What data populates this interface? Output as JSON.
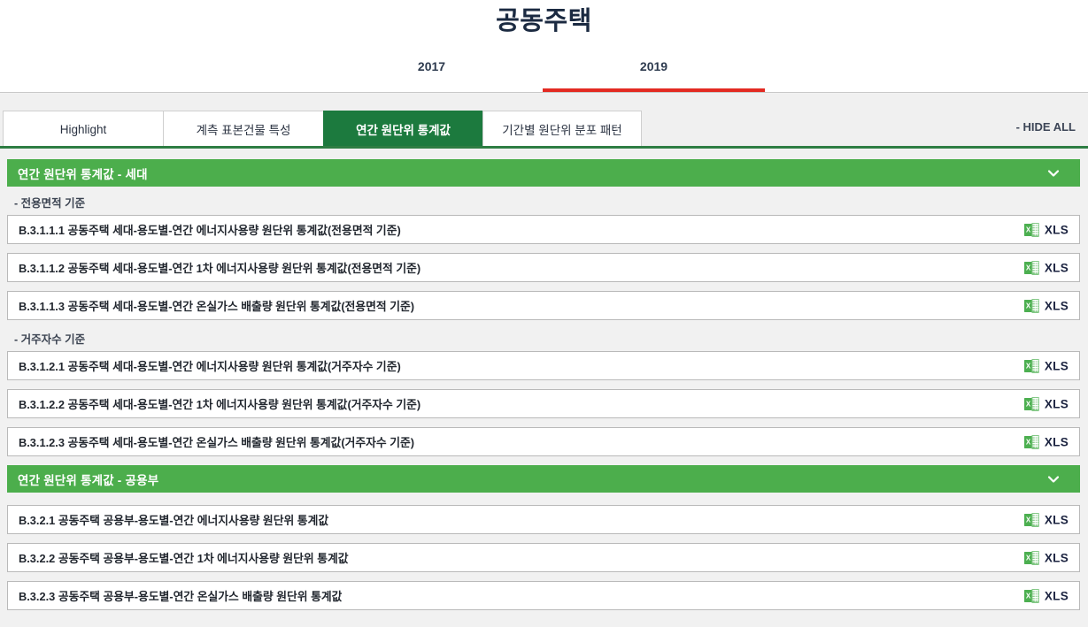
{
  "header": {
    "title": "공동주택",
    "year_tabs": [
      {
        "label": "2017",
        "active": false
      },
      {
        "label": "2019",
        "active": true
      }
    ]
  },
  "tabbar": {
    "tabs": [
      {
        "label": "Highlight",
        "active": false
      },
      {
        "label": "계측 표본건물 특성",
        "active": false
      },
      {
        "label": "연간 원단위 통계값",
        "active": true
      },
      {
        "label": "기간별 원단위 분포 패턴",
        "active": false
      }
    ],
    "hide_all_label": "- HIDE ALL"
  },
  "colors": {
    "active_tab_green": "#1c7a3e",
    "section_green": "#4cae4c",
    "rule_green": "#2e7d43",
    "active_year_red": "#e32a22",
    "xls_text": "#1b2340"
  },
  "xls": {
    "label": "XLS",
    "icon": "excel-xls-icon"
  },
  "sections": [
    {
      "title": "연간 원단위 통계값 - 세대",
      "toggle_icon": "chevron-down-icon",
      "groups": [
        {
          "label": "- 전용면적 기준",
          "rows": [
            {
              "title": "B.3.1.1.1 공동주택 세대-용도별-연간 에너지사용량 원단위 통계값(전용면적 기준)"
            },
            {
              "title": "B.3.1.1.2 공동주택 세대-용도별-연간 1차 에너지사용량 원단위 통계값(전용면적 기준)"
            },
            {
              "title": "B.3.1.1.3 공동주택 세대-용도별-연간 온실가스 배출량 원단위 통계값(전용면적 기준)"
            }
          ]
        },
        {
          "label": "- 거주자수 기준",
          "rows": [
            {
              "title": "B.3.1.2.1 공동주택 세대-용도별-연간 에너지사용량 원단위 통계값(거주자수 기준)"
            },
            {
              "title": "B.3.1.2.2 공동주택 세대-용도별-연간 1차 에너지사용량 원단위 통계값(거주자수 기준)"
            },
            {
              "title": "B.3.1.2.3 공동주택 세대-용도별-연간 온실가스 배출량 원단위 통계값(거주자수 기준)"
            }
          ]
        }
      ]
    },
    {
      "title": "연간 원단위 통계값 - 공용부",
      "toggle_icon": "chevron-down-icon",
      "groups": [
        {
          "label": null,
          "rows": [
            {
              "title": "B.3.2.1 공동주택 공용부-용도별-연간 에너지사용량 원단위 통계값"
            },
            {
              "title": "B.3.2.2 공동주택 공용부-용도별-연간 1차 에너지사용량 원단위 통계값"
            },
            {
              "title": "B.3.2.3 공동주택 공용부-용도별-연간 온실가스 배출량 원단위 통계값"
            }
          ]
        }
      ]
    }
  ]
}
